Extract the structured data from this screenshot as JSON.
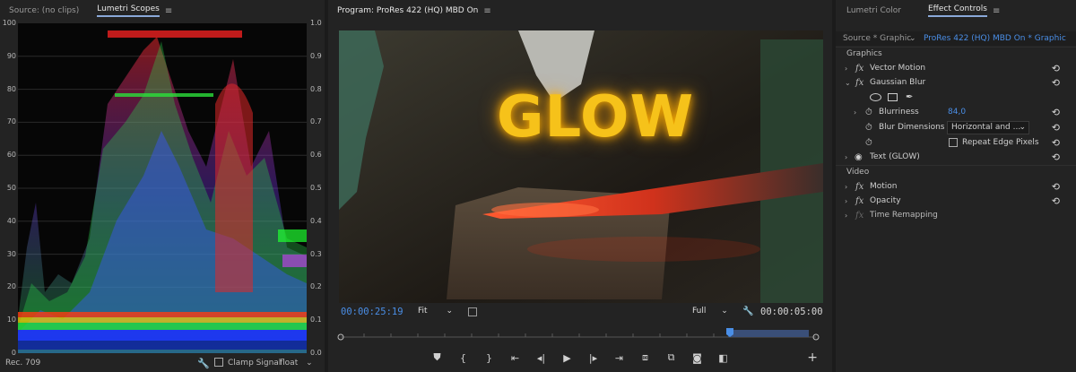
{
  "left_panel": {
    "tab_source": "Source: (no clips)",
    "tab_scopes": "Lumetri Scopes",
    "menu_glyph": "≡",
    "left_axis": [
      "100",
      "90",
      "80",
      "70",
      "60",
      "50",
      "40",
      "30",
      "20",
      "10",
      "0"
    ],
    "right_axis": [
      "1.0",
      "0.9",
      "0.8",
      "0.7",
      "0.6",
      "0.5",
      "0.4",
      "0.3",
      "0.2",
      "0.1",
      "0.0"
    ],
    "standard": "Rec. 709",
    "clamp_label": "Clamp Signal",
    "precision": "float"
  },
  "center_panel": {
    "title": "Program: ProRes 422 (HQ) MBD On",
    "menu_glyph": "≡",
    "overlay_text": "GLOW",
    "timecode_current": "00:00:25:19",
    "zoom": "Fit",
    "resolution": "Full",
    "timecode_duration": "00:00:05:00",
    "add_glyph": "+"
  },
  "right_panel": {
    "tab_lumetri": "Lumetri Color",
    "tab_effects": "Effect Controls",
    "menu_glyph": "≡",
    "source_label": "Source * Graphic",
    "sequence_label": "ProRes 422 (HQ) MBD On * Graphic",
    "section_graphics": "Graphics",
    "vector_motion": "Vector Motion",
    "gaussian_blur": "Gaussian Blur",
    "blurriness_label": "Blurriness",
    "blurriness_value": "84,0",
    "blur_dimensions_label": "Blur Dimensions",
    "blur_dimensions_value": "Horizontal and ...",
    "repeat_edge": "Repeat Edge Pixels",
    "text_layer": "Text (GLOW)",
    "section_video": "Video",
    "motion": "Motion",
    "opacity": "Opacity",
    "time_remapping": "Time Remapping",
    "fx_glyph": "fx",
    "reset_glyph": "⟲"
  },
  "colors": {
    "accent_blue": "#4a8ee6",
    "glow_yellow": "#f6c21a",
    "panel_bg": "#232323"
  }
}
